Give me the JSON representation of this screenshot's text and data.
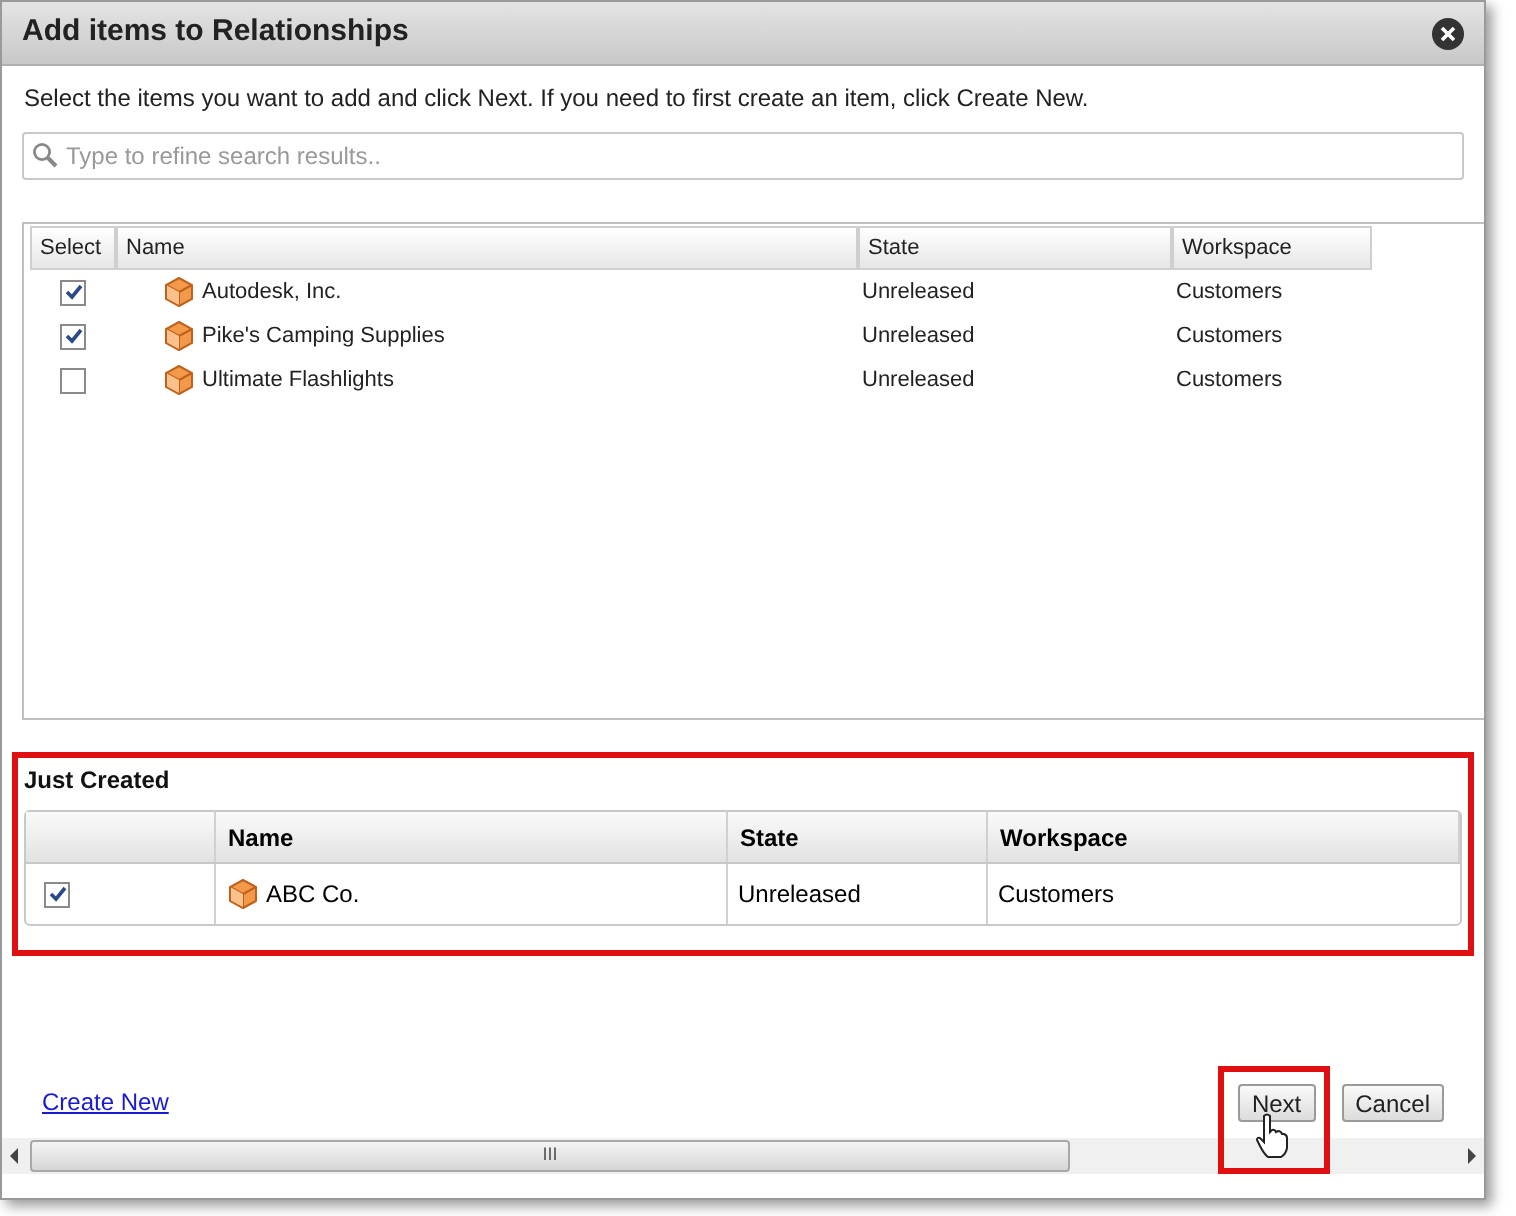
{
  "window": {
    "title": "Add items to Relationships"
  },
  "instructions": "Select the items you want to add and click Next. If you need to first create an item, click Create New.",
  "search": {
    "placeholder": "Type to refine search results.."
  },
  "table": {
    "columns": [
      "Select",
      "Name",
      "State",
      "Workspace"
    ],
    "rows": [
      {
        "checked": true,
        "name": "Autodesk, Inc.",
        "state": "Unreleased",
        "workspace": "Customers"
      },
      {
        "checked": true,
        "name": "Pike's Camping Supplies",
        "state": "Unreleased",
        "workspace": "Customers"
      },
      {
        "checked": false,
        "name": "Ultimate Flashlights",
        "state": "Unreleased",
        "workspace": "Customers"
      }
    ]
  },
  "just_created": {
    "title": "Just Created",
    "columns": [
      "Name",
      "State",
      "Workspace"
    ],
    "rows": [
      {
        "checked": true,
        "name": "ABC Co.",
        "state": "Unreleased",
        "workspace": "Customers"
      }
    ]
  },
  "create_link": "Create New",
  "buttons": [
    "Next",
    "Cancel"
  ],
  "scrollbar_grip": "III"
}
